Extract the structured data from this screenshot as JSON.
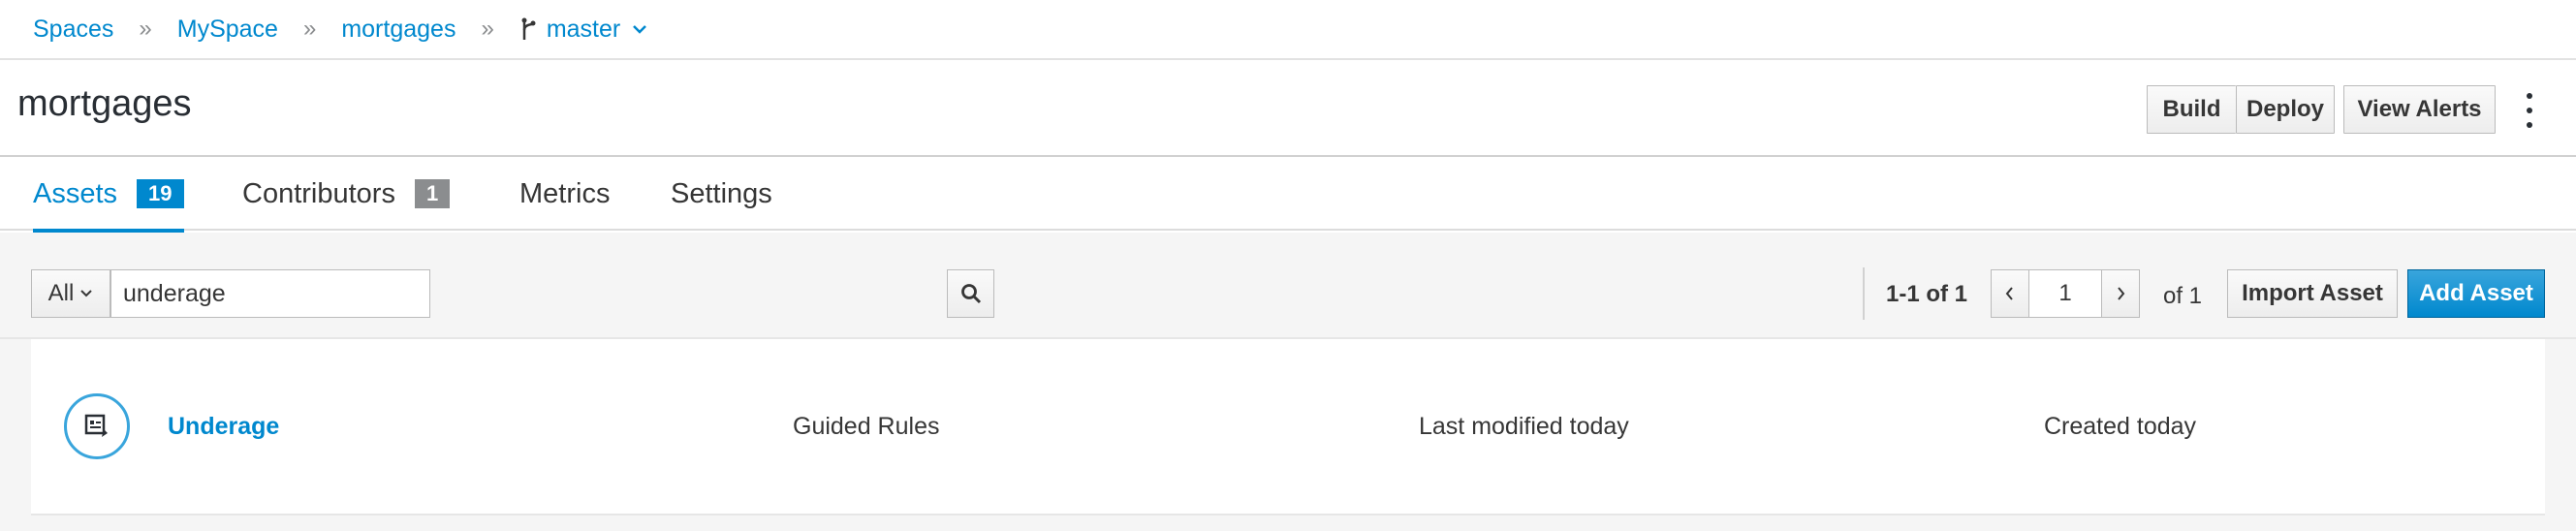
{
  "breadcrumb": {
    "items": [
      "Spaces",
      "MySpace",
      "mortgages"
    ],
    "separator": "»",
    "branch": "master"
  },
  "header": {
    "title": "mortgages",
    "build_label": "Build",
    "deploy_label": "Deploy",
    "alerts_label": "View Alerts",
    "kebab_icon": "kebab-vertical-icon"
  },
  "tabs": [
    {
      "label": "Assets",
      "badge": "19",
      "active": true
    },
    {
      "label": "Contributors",
      "badge": "1",
      "active": false
    },
    {
      "label": "Metrics",
      "active": false
    },
    {
      "label": "Settings",
      "active": false
    }
  ],
  "toolbar": {
    "filter_value": "All",
    "search_value": "underage",
    "search_icon": "search-icon",
    "page_range": "1-1 of 1",
    "page_number": "1",
    "page_total": "of 1",
    "import_label": "Import Asset",
    "add_label": "Add Asset"
  },
  "assets": [
    {
      "name": "Underage",
      "type": "Guided Rules",
      "modified": "Last modified today",
      "created": "Created today",
      "icon": "guided-rule-icon"
    }
  ],
  "colors": {
    "accent": "#0088ce",
    "badge_grey": "#8b8d8f",
    "icon_ring": "#39a5dc",
    "toolbar_bg": "#f5f5f5"
  }
}
